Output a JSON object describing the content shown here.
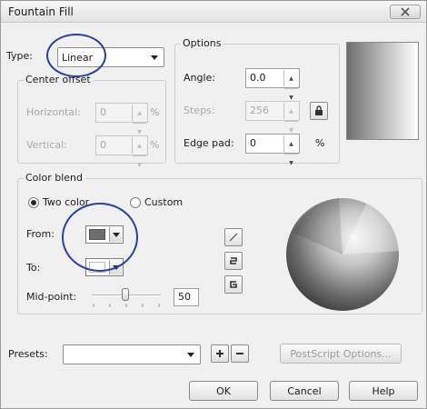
{
  "window": {
    "title": "Fountain Fill",
    "close_icon": "close-icon"
  },
  "type_select": {
    "label": "Type:",
    "value": "Linear"
  },
  "center_offset": {
    "title": "Center offset",
    "horizontal_label": "Horizontal:",
    "horizontal_value": "0",
    "vertical_label": "Vertical:",
    "vertical_value": "0",
    "unit": "%"
  },
  "options": {
    "title": "Options",
    "angle_label": "Angle:",
    "angle_value": "0.0",
    "steps_label": "Steps:",
    "steps_value": "256",
    "edge_pad_label": "Edge pad:",
    "edge_pad_value": "0",
    "unit": "%"
  },
  "color_blend": {
    "title": "Color blend",
    "two_color_label": "Two color",
    "custom_label": "Custom",
    "selected": "Two color",
    "from_label": "From:",
    "from_color": "#6e6e6e",
    "to_label": "To:",
    "to_color": "#ffffff",
    "midpoint_label": "Mid-point:",
    "midpoint_value": "50"
  },
  "presets": {
    "label": "Presets:",
    "value": ""
  },
  "buttons": {
    "postscript": "PostScript Options...",
    "ok": "OK",
    "cancel": "Cancel",
    "help": "Help"
  },
  "colors": {
    "annotation": "#2b3fa3",
    "dialog_bg": "#f0f0f0"
  }
}
